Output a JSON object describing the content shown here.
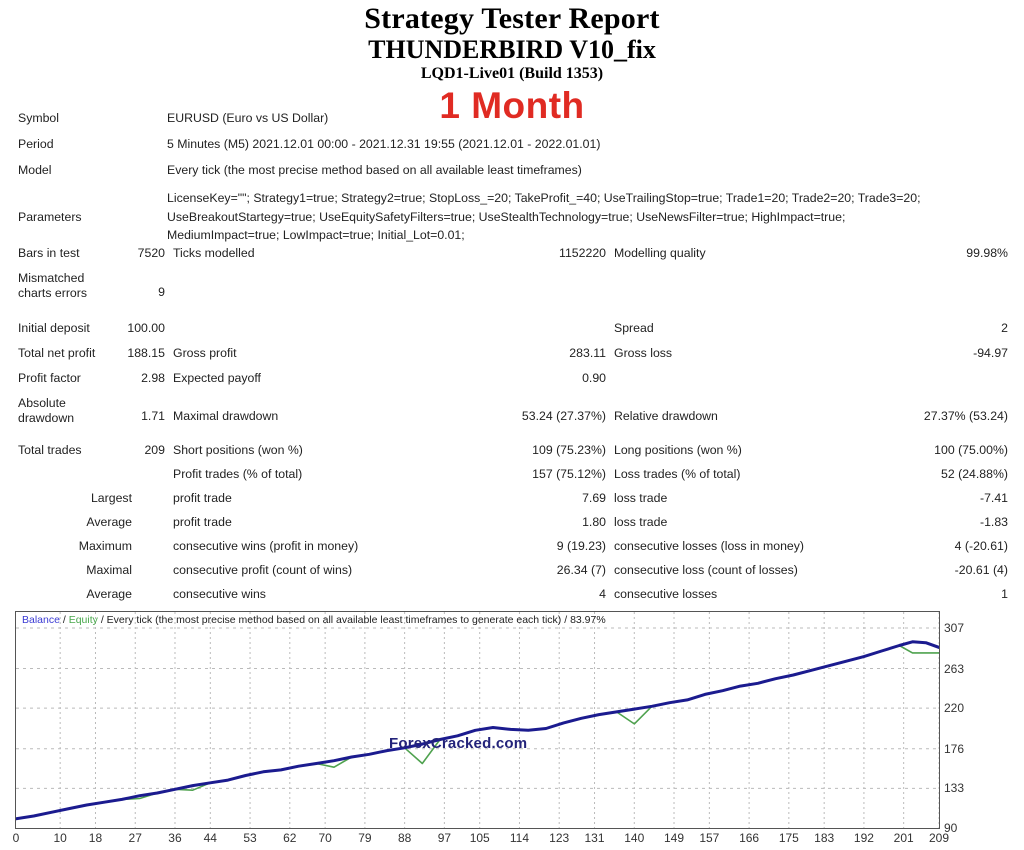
{
  "report": {
    "title": "Strategy Tester Report",
    "ea_name": "THUNDERBIRD V10_fix",
    "broker_build": "LQD1-Live01 (Build 1353)",
    "period_badge": "1 Month"
  },
  "info": {
    "symbol_label": "Symbol",
    "symbol_value": "EURUSD (Euro vs US Dollar)",
    "period_label": "Period",
    "period_value": "5 Minutes (M5) 2021.12.01 00:00 - 2021.12.31 19:55 (2021.12.01 - 2022.01.01)",
    "model_label": "Model",
    "model_value": "Every tick (the most precise method based on all available least timeframes)",
    "parameters_label": "Parameters",
    "parameters_line1": "LicenseKey=\"\"; Strategy1=true; Strategy2=true; StopLoss_=20; TakeProfit_=40; UseTrailingStop=true; Trade1=20; Trade2=20; Trade3=20;",
    "parameters_line2": "UseBreakoutStartegy=true; UseEquitySafetyFilters=true; UseStealthTechnology=true; UseNewsFilter=true; HighImpact=true;",
    "parameters_line3": "MediumImpact=true; LowImpact=true; Initial_Lot=0.01;"
  },
  "modelling": {
    "bars_label": "Bars in test",
    "bars_value": "7520",
    "ticks_label": "Ticks modelled",
    "ticks_value": "1152220",
    "quality_label": "Modelling quality",
    "quality_value": "99.98%",
    "mismatched_label_l1": "Mismatched",
    "mismatched_label_l2": "charts errors",
    "mismatched_value": "9"
  },
  "money": [
    {
      "l1": "Initial deposit",
      "v1": "100.00",
      "l2": "",
      "v2": "",
      "l3": "Spread",
      "v3": "2"
    },
    {
      "l1": "Total net profit",
      "v1": "188.15",
      "l2": "Gross profit",
      "v2": "283.11",
      "l3": "Gross loss",
      "v3": "-94.97"
    },
    {
      "l1": "Profit factor",
      "v1": "2.98",
      "l2": "Expected payoff",
      "v2": "0.90",
      "l3": "",
      "v3": ""
    },
    {
      "l1a": "Absolute",
      "l1b": "drawdown",
      "v1": "1.71",
      "l2": "Maximal drawdown",
      "v2": "53.24 (27.37%)",
      "l3": "Relative drawdown",
      "v3": "27.37% (53.24)"
    }
  ],
  "trades": [
    {
      "c1": "Total trades",
      "c2": "209",
      "c3": "Short positions (won %)",
      "c4": "109 (75.23%)",
      "c5": "Long positions (won %)",
      "c6": "100 (75.00%)"
    },
    {
      "c1": "",
      "c2": "",
      "c3": "Profit trades (% of total)",
      "c4": "157 (75.12%)",
      "c5": "Loss trades (% of total)",
      "c6": "52 (24.88%)"
    },
    {
      "c1": "Largest",
      "c2": "",
      "c3": "profit trade",
      "c4": "7.69",
      "c5": "loss trade",
      "c6": "-7.41"
    },
    {
      "c1": "Average",
      "c2": "",
      "c3": "profit trade",
      "c4": "1.80",
      "c5": "loss trade",
      "c6": "-1.83"
    },
    {
      "c1": "Maximum",
      "c2": "",
      "c3": "consecutive wins (profit in money)",
      "c4": "9 (19.23)",
      "c5": "consecutive losses (loss in money)",
      "c6": "4 (-20.61)"
    },
    {
      "c1": "Maximal",
      "c2": "",
      "c3": "consecutive profit (count of wins)",
      "c4": "26.34 (7)",
      "c5": "consecutive loss (count of losses)",
      "c6": "-20.61 (4)"
    },
    {
      "c1": "Average",
      "c2": "",
      "c3": "consecutive wins",
      "c4": "4",
      "c5": "consecutive losses",
      "c6": "1"
    }
  ],
  "chart_legend": {
    "balance": "Balance",
    "equity": "Equity",
    "sep1": " / ",
    "sep2": " / ",
    "description": "Every tick (the most precise method based on all available least timeframes to generate each tick)",
    "sep3": " / ",
    "quality": "83.97%"
  },
  "watermark": "ForexCracked.com",
  "colors": {
    "balance_line": "#1b1b8f",
    "equity_line": "#4fa24f",
    "accent_red": "#e02b23",
    "grid": "#bbbbbb"
  },
  "chart_data": {
    "type": "line",
    "title": "Balance / Equity",
    "xlabel": "",
    "ylabel": "",
    "grid": true,
    "legend_position": "top-left",
    "xlim": [
      0,
      209
    ],
    "ylim": [
      90,
      307
    ],
    "xticks": [
      0,
      10,
      18,
      27,
      36,
      44,
      53,
      62,
      70,
      79,
      88,
      97,
      105,
      114,
      123,
      131,
      140,
      149,
      157,
      166,
      175,
      183,
      192,
      201,
      209
    ],
    "yticks": [
      90,
      133,
      176,
      220,
      263,
      307
    ],
    "x": [
      0,
      4,
      8,
      12,
      16,
      20,
      24,
      28,
      32,
      36,
      40,
      44,
      48,
      52,
      56,
      60,
      64,
      68,
      72,
      76,
      80,
      84,
      88,
      92,
      96,
      100,
      104,
      108,
      112,
      116,
      120,
      124,
      128,
      132,
      136,
      140,
      144,
      148,
      152,
      156,
      160,
      164,
      168,
      172,
      176,
      180,
      184,
      188,
      192,
      196,
      200,
      203,
      206,
      209
    ],
    "series": [
      {
        "name": "Balance",
        "color": "#1b1b8f",
        "values": [
          100,
          103,
          107,
          111,
          115,
          118,
          121,
          125,
          128,
          132,
          136,
          139,
          142,
          147,
          151,
          153,
          157,
          160,
          163,
          167,
          170,
          174,
          177,
          181,
          186,
          190,
          196,
          199,
          197,
          196,
          198,
          204,
          209,
          213,
          216,
          219,
          222,
          226,
          229,
          235,
          239,
          244,
          247,
          252,
          256,
          261,
          266,
          271,
          276,
          282,
          288,
          292,
          291,
          286
        ]
      },
      {
        "name": "Equity",
        "color": "#4fa24f",
        "values": [
          100,
          103,
          107,
          111,
          115,
          118,
          121,
          122,
          128,
          132,
          131,
          139,
          142,
          147,
          151,
          153,
          157,
          160,
          156,
          167,
          170,
          174,
          177,
          160,
          186,
          190,
          196,
          199,
          197,
          196,
          198,
          204,
          209,
          213,
          216,
          203,
          222,
          226,
          229,
          235,
          239,
          244,
          247,
          252,
          256,
          261,
          266,
          271,
          276,
          282,
          288,
          280,
          280,
          280
        ]
      }
    ]
  }
}
